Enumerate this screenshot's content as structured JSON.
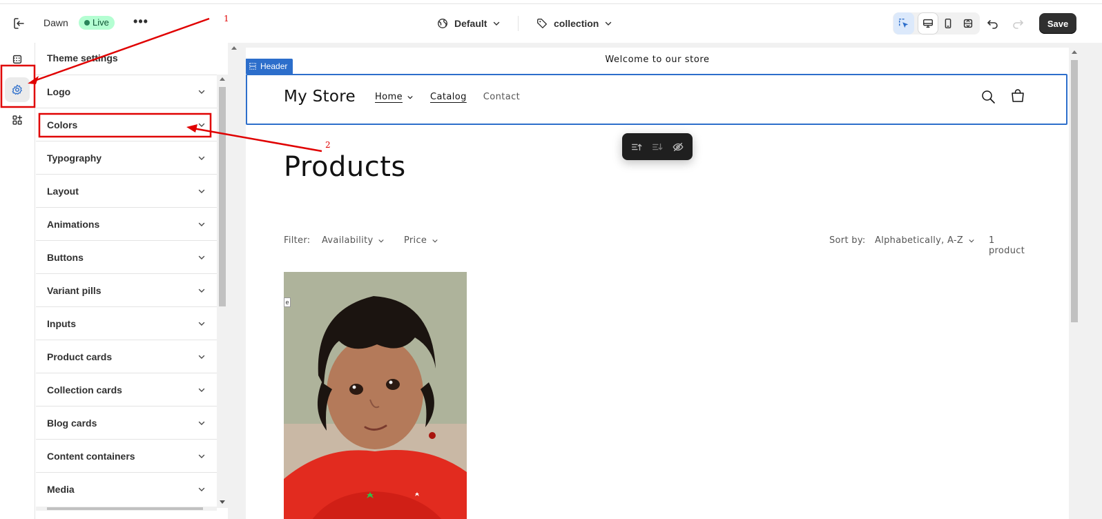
{
  "topbar": {
    "theme_name": "Dawn",
    "status_badge": "Live",
    "more_label": "•••",
    "template_dropdown": "Default",
    "collection_dropdown": "collection",
    "save_label": "Save"
  },
  "panel": {
    "title": "Theme settings",
    "items": [
      {
        "label": "Logo"
      },
      {
        "label": "Colors"
      },
      {
        "label": "Typography"
      },
      {
        "label": "Layout"
      },
      {
        "label": "Animations"
      },
      {
        "label": "Buttons"
      },
      {
        "label": "Variant pills"
      },
      {
        "label": "Inputs"
      },
      {
        "label": "Product cards"
      },
      {
        "label": "Collection cards"
      },
      {
        "label": "Blog cards"
      },
      {
        "label": "Content containers"
      },
      {
        "label": "Media"
      }
    ]
  },
  "preview": {
    "announcement": "Welcome to our store",
    "header_tag": "Header",
    "store_name": "My Store",
    "nav": [
      "Home",
      "Catalog",
      "Contact"
    ],
    "page_title": "Products",
    "filter_label": "Filter:",
    "filter_availability": "Availability",
    "filter_price": "Price",
    "sort_label": "Sort by:",
    "sort_value": "Alphabetically, A-Z",
    "product_count": "1 product",
    "image_badge": "e"
  },
  "annotations": {
    "label_1": "1",
    "label_2": "2",
    "color": "#e00000"
  },
  "colors": {
    "accent": "#2c6ecb",
    "live_bg": "#b4fed2",
    "save_bg": "#303030"
  }
}
